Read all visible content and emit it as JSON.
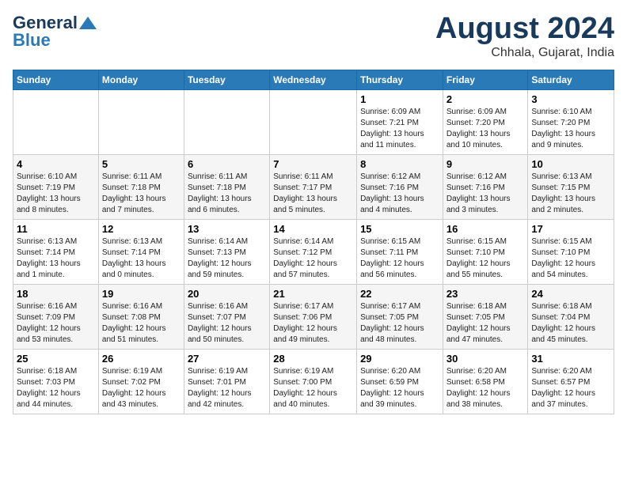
{
  "header": {
    "logo_line1": "General",
    "logo_line2": "Blue",
    "month": "August 2024",
    "location": "Chhala, Gujarat, India"
  },
  "days_of_week": [
    "Sunday",
    "Monday",
    "Tuesday",
    "Wednesday",
    "Thursday",
    "Friday",
    "Saturday"
  ],
  "weeks": [
    [
      {
        "day": "",
        "info": ""
      },
      {
        "day": "",
        "info": ""
      },
      {
        "day": "",
        "info": ""
      },
      {
        "day": "",
        "info": ""
      },
      {
        "day": "1",
        "info": "Sunrise: 6:09 AM\nSunset: 7:21 PM\nDaylight: 13 hours\nand 11 minutes."
      },
      {
        "day": "2",
        "info": "Sunrise: 6:09 AM\nSunset: 7:20 PM\nDaylight: 13 hours\nand 10 minutes."
      },
      {
        "day": "3",
        "info": "Sunrise: 6:10 AM\nSunset: 7:20 PM\nDaylight: 13 hours\nand 9 minutes."
      }
    ],
    [
      {
        "day": "4",
        "info": "Sunrise: 6:10 AM\nSunset: 7:19 PM\nDaylight: 13 hours\nand 8 minutes."
      },
      {
        "day": "5",
        "info": "Sunrise: 6:11 AM\nSunset: 7:18 PM\nDaylight: 13 hours\nand 7 minutes."
      },
      {
        "day": "6",
        "info": "Sunrise: 6:11 AM\nSunset: 7:18 PM\nDaylight: 13 hours\nand 6 minutes."
      },
      {
        "day": "7",
        "info": "Sunrise: 6:11 AM\nSunset: 7:17 PM\nDaylight: 13 hours\nand 5 minutes."
      },
      {
        "day": "8",
        "info": "Sunrise: 6:12 AM\nSunset: 7:16 PM\nDaylight: 13 hours\nand 4 minutes."
      },
      {
        "day": "9",
        "info": "Sunrise: 6:12 AM\nSunset: 7:16 PM\nDaylight: 13 hours\nand 3 minutes."
      },
      {
        "day": "10",
        "info": "Sunrise: 6:13 AM\nSunset: 7:15 PM\nDaylight: 13 hours\nand 2 minutes."
      }
    ],
    [
      {
        "day": "11",
        "info": "Sunrise: 6:13 AM\nSunset: 7:14 PM\nDaylight: 13 hours\nand 1 minute."
      },
      {
        "day": "12",
        "info": "Sunrise: 6:13 AM\nSunset: 7:14 PM\nDaylight: 13 hours\nand 0 minutes."
      },
      {
        "day": "13",
        "info": "Sunrise: 6:14 AM\nSunset: 7:13 PM\nDaylight: 12 hours\nand 59 minutes."
      },
      {
        "day": "14",
        "info": "Sunrise: 6:14 AM\nSunset: 7:12 PM\nDaylight: 12 hours\nand 57 minutes."
      },
      {
        "day": "15",
        "info": "Sunrise: 6:15 AM\nSunset: 7:11 PM\nDaylight: 12 hours\nand 56 minutes."
      },
      {
        "day": "16",
        "info": "Sunrise: 6:15 AM\nSunset: 7:10 PM\nDaylight: 12 hours\nand 55 minutes."
      },
      {
        "day": "17",
        "info": "Sunrise: 6:15 AM\nSunset: 7:10 PM\nDaylight: 12 hours\nand 54 minutes."
      }
    ],
    [
      {
        "day": "18",
        "info": "Sunrise: 6:16 AM\nSunset: 7:09 PM\nDaylight: 12 hours\nand 53 minutes."
      },
      {
        "day": "19",
        "info": "Sunrise: 6:16 AM\nSunset: 7:08 PM\nDaylight: 12 hours\nand 51 minutes."
      },
      {
        "day": "20",
        "info": "Sunrise: 6:16 AM\nSunset: 7:07 PM\nDaylight: 12 hours\nand 50 minutes."
      },
      {
        "day": "21",
        "info": "Sunrise: 6:17 AM\nSunset: 7:06 PM\nDaylight: 12 hours\nand 49 minutes."
      },
      {
        "day": "22",
        "info": "Sunrise: 6:17 AM\nSunset: 7:05 PM\nDaylight: 12 hours\nand 48 minutes."
      },
      {
        "day": "23",
        "info": "Sunrise: 6:18 AM\nSunset: 7:05 PM\nDaylight: 12 hours\nand 47 minutes."
      },
      {
        "day": "24",
        "info": "Sunrise: 6:18 AM\nSunset: 7:04 PM\nDaylight: 12 hours\nand 45 minutes."
      }
    ],
    [
      {
        "day": "25",
        "info": "Sunrise: 6:18 AM\nSunset: 7:03 PM\nDaylight: 12 hours\nand 44 minutes."
      },
      {
        "day": "26",
        "info": "Sunrise: 6:19 AM\nSunset: 7:02 PM\nDaylight: 12 hours\nand 43 minutes."
      },
      {
        "day": "27",
        "info": "Sunrise: 6:19 AM\nSunset: 7:01 PM\nDaylight: 12 hours\nand 42 minutes."
      },
      {
        "day": "28",
        "info": "Sunrise: 6:19 AM\nSunset: 7:00 PM\nDaylight: 12 hours\nand 40 minutes."
      },
      {
        "day": "29",
        "info": "Sunrise: 6:20 AM\nSunset: 6:59 PM\nDaylight: 12 hours\nand 39 minutes."
      },
      {
        "day": "30",
        "info": "Sunrise: 6:20 AM\nSunset: 6:58 PM\nDaylight: 12 hours\nand 38 minutes."
      },
      {
        "day": "31",
        "info": "Sunrise: 6:20 AM\nSunset: 6:57 PM\nDaylight: 12 hours\nand 37 minutes."
      }
    ]
  ]
}
